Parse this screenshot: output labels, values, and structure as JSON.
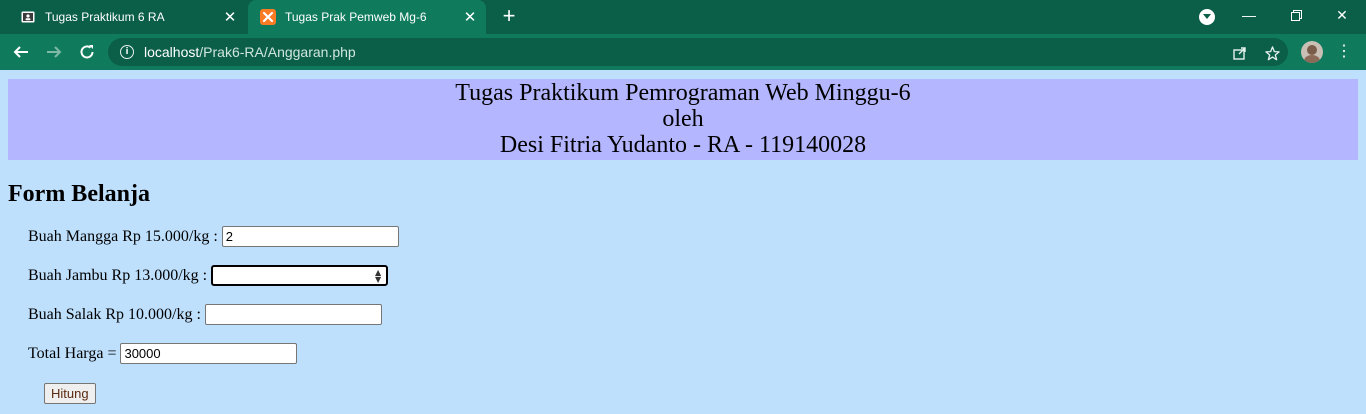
{
  "browser": {
    "tabs": [
      {
        "title": "Tugas Praktikum 6 RA",
        "active": false
      },
      {
        "title": "Tugas Prak Pemweb Mg-6",
        "active": true
      }
    ],
    "url_host": "localhost",
    "url_path": "/Prak6-RA/Anggaran.php"
  },
  "banner": {
    "line1": "Tugas Praktikum Pemrograman Web Minggu-6",
    "line2": "oleh",
    "line3": "Desi Fitria Yudanto - RA - 119140028",
    "bg_color": "#b4b6ff"
  },
  "form": {
    "title": "Form Belanja",
    "mangga_label": "Buah Mangga Rp 15.000/kg :",
    "mangga_value": "2",
    "jambu_label": "Buah Jambu Rp 13.000/kg :",
    "jambu_value": "",
    "salak_label": "Buah Salak Rp 10.000/kg :",
    "salak_value": "",
    "total_label": "Total Harga =",
    "total_value": "30000",
    "submit_label": "Hitung"
  },
  "colors": {
    "page_bg": "#bee0fd",
    "chrome_dark": "#0b5e48",
    "chrome_toolbar": "#0f7b5c"
  }
}
